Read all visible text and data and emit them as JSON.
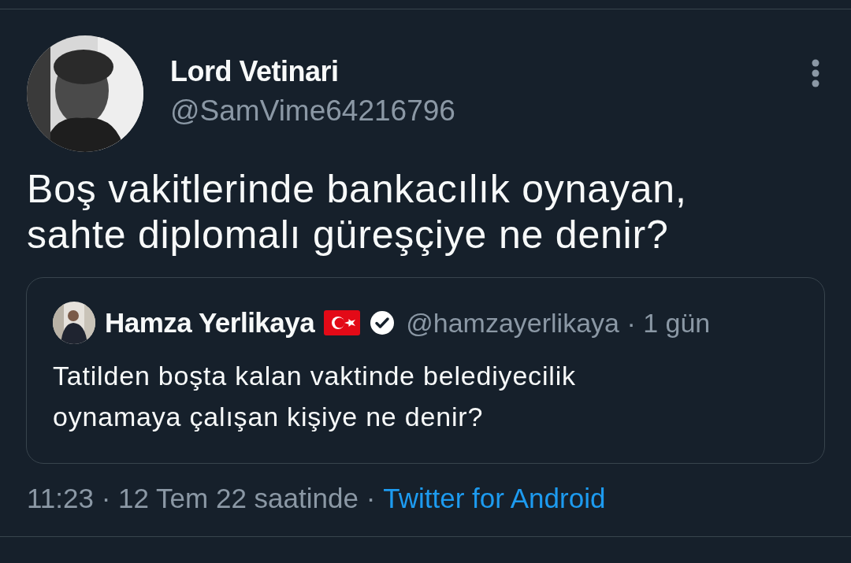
{
  "tweet": {
    "author": {
      "name": "Lord Vetinari",
      "handle": "@SamVime64216796"
    },
    "text": "Boş vakitlerinde bankacılık oynayan, sahte diplomalı güreşçiye ne denir?",
    "quote": {
      "name": "Hamza Yerlikaya",
      "verified": true,
      "handle_time": "@hamzayerlikaya · 1 gün",
      "text": "Tatilden boşta kalan vaktinde belediyecilik oynamaya çalışan kişiye ne denir?"
    },
    "meta": "11:23 · 12 Tem 22 saatinde ·",
    "source": "Twitter for Android"
  }
}
